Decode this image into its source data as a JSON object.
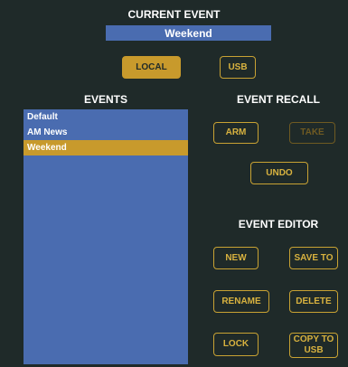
{
  "current_event": {
    "title": "CURRENT EVENT",
    "value": "Weekend"
  },
  "source": {
    "local_label": "LOCAL",
    "usb_label": "USB",
    "selected": "LOCAL"
  },
  "events": {
    "title": "EVENTS",
    "items": [
      "Default",
      "AM News",
      "Weekend"
    ],
    "selected_index": 2
  },
  "event_recall": {
    "title": "EVENT RECALL",
    "arm_label": "ARM",
    "take_label": "TAKE",
    "undo_label": "UNDO"
  },
  "event_editor": {
    "title": "EVENT EDITOR",
    "new_label": "NEW",
    "save_to_label": "SAVE TO",
    "rename_label": "RENAME",
    "delete_label": "DELETE",
    "lock_label": "LOCK",
    "copy_to_usb_label": "COPY TO USB"
  },
  "colors": {
    "background": "#1f2a29",
    "accent": "#c89a2c",
    "list_blue": "#4a6cb0"
  }
}
